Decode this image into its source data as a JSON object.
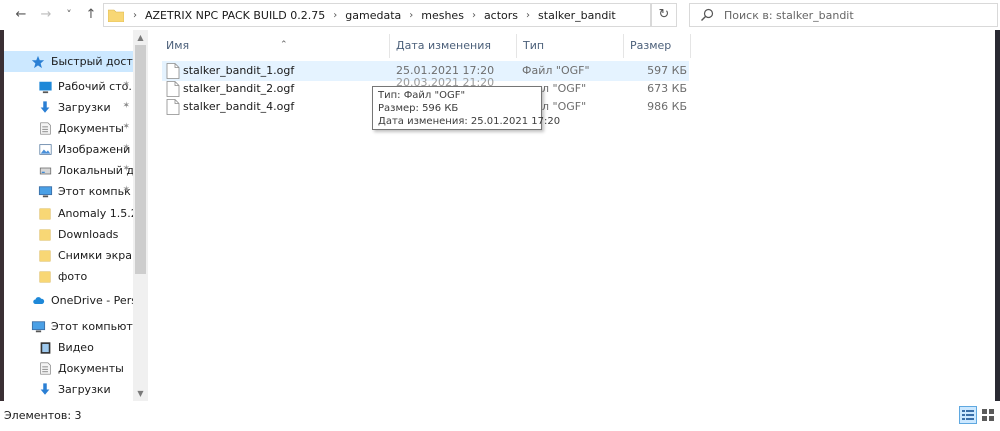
{
  "addressbar": {
    "back_glyph": "←",
    "forward_glyph": "→",
    "history_glyph": "˅",
    "up_glyph": "↑",
    "path": [
      "AZETRIX NPC PACK BUILD 0.2.75",
      "gamedata",
      "meshes",
      "actors",
      "stalker_bandit"
    ],
    "separator": "›",
    "refresh_glyph": "↻",
    "search_placeholder": "Поиск в: stalker_bandit"
  },
  "navigation": {
    "items": [
      {
        "label": "Быстрый доступ",
        "icon": "star-icon",
        "pinned": false,
        "selected": true
      },
      {
        "label": "Рабочий сто.",
        "icon": "desktop-icon",
        "pinned": true
      },
      {
        "label": "Загрузки",
        "icon": "download-icon",
        "pinned": true
      },
      {
        "label": "Документы",
        "icon": "documents-icon",
        "pinned": true
      },
      {
        "label": "Изображени",
        "icon": "pictures-icon",
        "pinned": true
      },
      {
        "label": "Локальный д",
        "icon": "drive-icon",
        "pinned": true
      },
      {
        "label": "Этот компьк",
        "icon": "computer-icon",
        "pinned": true
      },
      {
        "label": "Anomaly 1.5.2 —",
        "icon": "folder-icon",
        "pinned": false
      },
      {
        "label": "Downloads",
        "icon": "folder-icon",
        "pinned": false
      },
      {
        "label": "Снимки экрана",
        "icon": "folder-icon",
        "pinned": false
      },
      {
        "label": "фото",
        "icon": "folder-icon",
        "pinned": false
      },
      {
        "label": "OneDrive - Persor",
        "icon": "cloud-icon",
        "pinned": false
      },
      {
        "label": "Этот компьютер",
        "icon": "computer-icon",
        "pinned": false
      },
      {
        "label": "Видео",
        "icon": "video-icon",
        "pinned": false
      },
      {
        "label": "Документы",
        "icon": "documents-icon",
        "pinned": false
      },
      {
        "label": "Загрузки",
        "icon": "download-icon",
        "pinned": false
      }
    ]
  },
  "columns": {
    "name": "Имя",
    "date": "Дата изменения",
    "type": "Тип",
    "size": "Размер"
  },
  "files": [
    {
      "name": "stalker_bandit_1.ogf",
      "date": "25.01.2021 17:20",
      "type": "Файл \"OGF\"",
      "size": "597 КБ"
    },
    {
      "name": "stalker_bandit_2.ogf",
      "date": "",
      "type": "",
      "size": "673 КБ"
    },
    {
      "name": "stalker_bandit_4.ogf",
      "date": "",
      "type": "",
      "size": "986 КБ"
    }
  ],
  "tooltip": {
    "type_line": "Тип: Файл \"OGF\"",
    "size_line": "Размер: 596 КБ",
    "date_line": "Дата изменения: 25.01.2021 17:20"
  },
  "partial_row_text": {
    "row2_type_fragment": "л \"OGF\"",
    "row3_type_fragment": "л \"OGF\"",
    "row2_date_fragment": "20.03.2021 21:20"
  },
  "status": {
    "items_count": "Элементов: 3"
  },
  "colors": {
    "selection": "#cce8ff",
    "hover": "#e5f3ff",
    "header_text": "#4c607a",
    "folder": "#f8d775"
  }
}
